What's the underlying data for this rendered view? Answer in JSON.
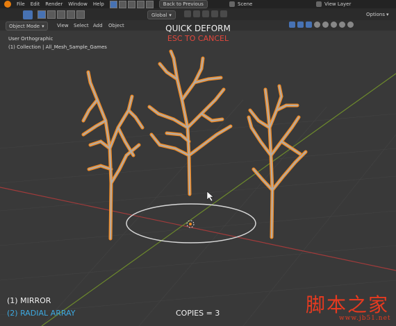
{
  "menu": {
    "items": [
      "File",
      "Edit",
      "Render",
      "Window",
      "Help"
    ],
    "back_label": "Back to Previous"
  },
  "scene": {
    "label": "Scene"
  },
  "view_layer": {
    "label": "View Layer"
  },
  "toolbar": {
    "transform_orientation": "Global",
    "options_label": "Options"
  },
  "header2": {
    "mode": "Object Mode",
    "view": "View",
    "select": "Select",
    "add": "Add",
    "object": "Object"
  },
  "overlay": {
    "view_name": "User Orthographic",
    "collection": "(1) Collection | All_Mesh_Sample_Games",
    "title": "QUICK DEFORM",
    "subtitle": "ESC TO CANCEL",
    "mirror": "(1) MIRROR",
    "radial": "(2) RADIAL ARRAY",
    "copies": "COPIES = 3"
  },
  "watermark": {
    "text": "脚本之家",
    "url": "www.jb51.net"
  },
  "colors": {
    "outline": "#f08a24",
    "branch": "#b4aca4",
    "red_axis": "#a23b3b",
    "green_axis": "#6d8a2c",
    "ring": "#d8d8d8"
  },
  "icons": [
    "blender-logo",
    "select-tool-icon",
    "cursor-icon",
    "pivot-icon",
    "snap-icon",
    "shading-icons"
  ]
}
